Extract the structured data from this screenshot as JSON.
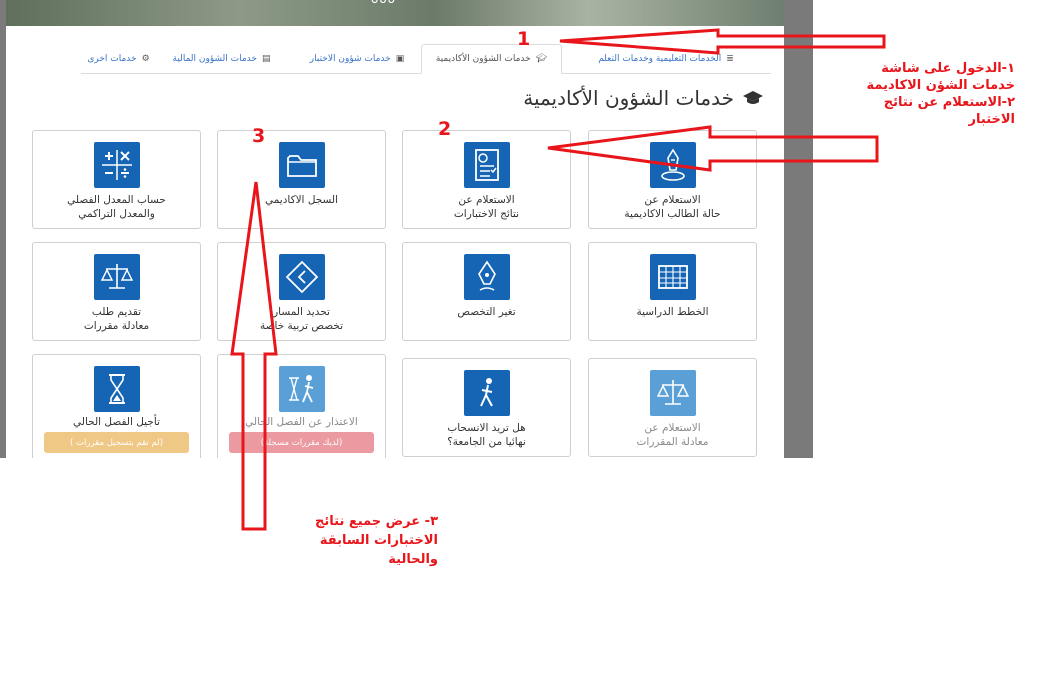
{
  "hero": {
    "dots": "ooo"
  },
  "tabs": [
    {
      "label": "خدمات اخرى",
      "icon": "gear-icon"
    },
    {
      "label": "خدمات الشؤون المالية",
      "icon": "money-icon"
    },
    {
      "label": "خدمات شؤون الاختبار",
      "icon": "exam-icon"
    },
    {
      "label": "خدمات الشؤون الأكاديمية",
      "icon": "graduation-cap-icon",
      "active": true
    },
    {
      "label": "الخدمات التعليمية وخدمات التعلم",
      "icon": "list-icon"
    }
  ],
  "page_title": "خدمات الشؤون الأكاديمية",
  "cards": {
    "gpa_calc": {
      "line1": "حساب المعدل الفصلي",
      "line2": "والمعدل التراكمي",
      "icon": "calculator-icon"
    },
    "academic_record": {
      "line1": "السجل الاكاديمي",
      "icon": "folder-icon"
    },
    "exam_results": {
      "line1": "الاستعلام عن",
      "line2": "نتائج الاختبارات",
      "icon": "exam-results-icon"
    },
    "student_status": {
      "line1": "الاستعلام عن",
      "line2": "حالة الطالب الاكاديمية",
      "icon": "student-status-icon"
    },
    "course_equivalency_request": {
      "line1": "تقديم طلب",
      "line2": "معادلة مقررات",
      "icon": "scales-icon"
    },
    "track_selection": {
      "line1": "تحديد المسار",
      "line2": "تخصص تربية خاصة",
      "icon": "direction-icon"
    },
    "change_major": {
      "line1": "تغير التخصص",
      "icon": "pen-nib-icon"
    },
    "study_plans": {
      "line1": "الخطط الدراسية",
      "icon": "table-icon"
    },
    "postpone_semester": {
      "line1": "تأجيل الفصل الحالي",
      "badge": "(لم تقم بتسجيل مقررات )",
      "badge_color": "#f0c886",
      "icon": "hourglass-icon"
    },
    "withdraw_semester": {
      "line1": "الاعتذار عن الفصل الحالي",
      "badge": "(لديك مقررات مسجلة)",
      "badge_color": "#ec9aa2",
      "icon": "hourglass-walk-icon"
    },
    "withdraw_university": {
      "line1": "هل تريد الانسحاب",
      "line2": "نهائيا من الجامعة؟",
      "icon": "walking-person-icon"
    },
    "equivalency_inquiry": {
      "line1": "الاستعلام عن",
      "line2": "معادلة المقررات",
      "icon": "scales-icon"
    }
  },
  "annotations": {
    "n1": "1",
    "n2": "2",
    "n3": "3",
    "step1_line1": "١-الدخول على شاشة",
    "step1_line2": "خدمات الشؤن الاكاديمة",
    "step2_line1": "٢-الاستعلام عن نتائج",
    "step2_line2": "الاختبار",
    "step3_line1": "٣- عرض جميع نتائج",
    "step3_line2": "الاختبارات السابقة",
    "step3_line3": "والحالية"
  },
  "colors": {
    "icon_bg": "#1565b4",
    "icon_bg_dim": "#5aa0d6",
    "tab_link": "#3b73c7",
    "annotation_red": "#e8151b"
  }
}
